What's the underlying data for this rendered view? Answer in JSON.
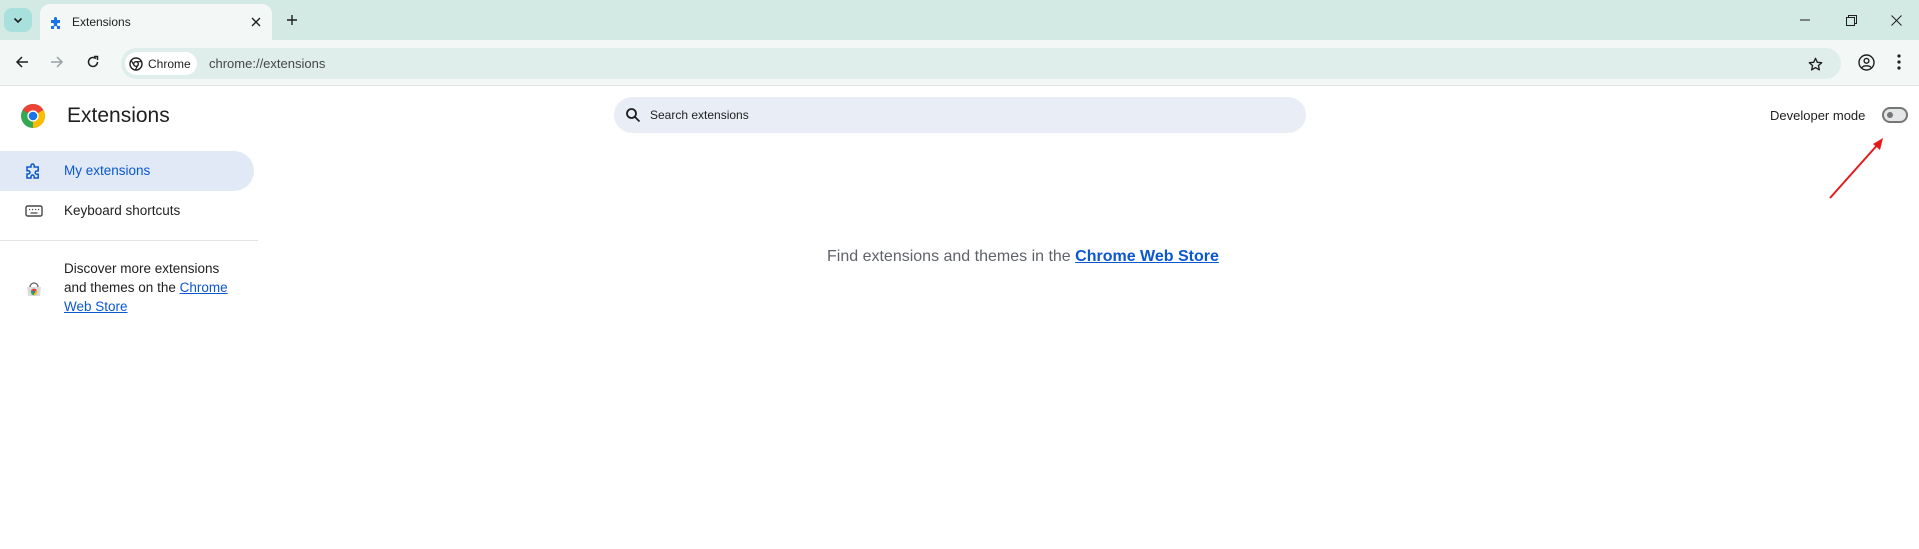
{
  "browser": {
    "tab": {
      "title": "Extensions"
    },
    "omnibox": {
      "chip_label": "Chrome",
      "url": "chrome://extensions"
    }
  },
  "page": {
    "title": "Extensions",
    "search": {
      "placeholder": "Search extensions"
    },
    "developer_mode": {
      "label": "Developer mode",
      "enabled": false
    },
    "sidebar": {
      "items": [
        {
          "label": "My extensions",
          "active": true
        },
        {
          "label": "Keyboard shortcuts",
          "active": false
        }
      ],
      "discover_prefix": "Discover more extensions and themes on the ",
      "discover_link": "Chrome Web Store"
    },
    "empty_state": {
      "prefix": "Find extensions and themes in the ",
      "link": "Chrome Web Store"
    }
  },
  "colors": {
    "tabstrip": "#d3e9e4",
    "accent": "#0b57d0",
    "active_nav_bg": "#e1e9f7",
    "annotation_arrow": "#e5191c"
  }
}
